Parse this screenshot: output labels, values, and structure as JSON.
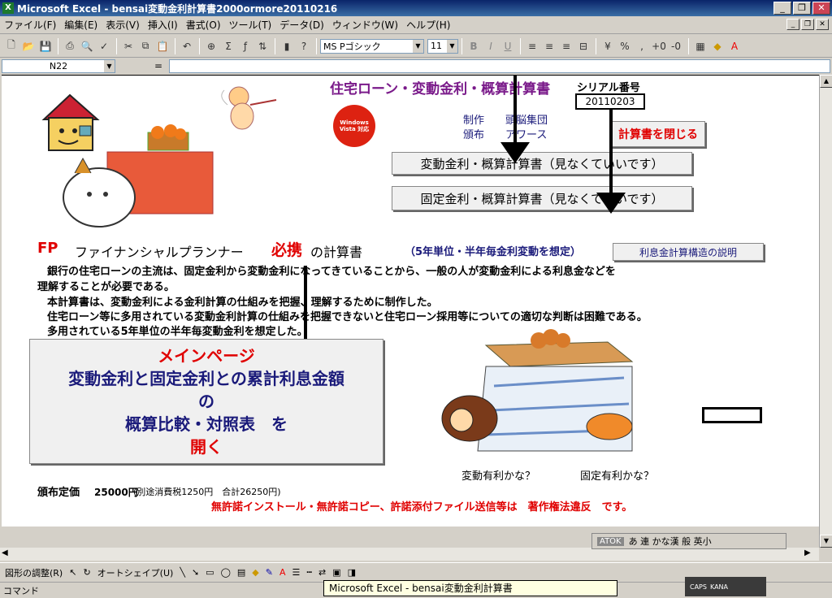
{
  "window": {
    "title": "Microsoft Excel - bensai変動金利計算書2000ormore20110216"
  },
  "menu": [
    "ファイル(F)",
    "編集(E)",
    "表示(V)",
    "挿入(I)",
    "書式(O)",
    "ツール(T)",
    "データ(D)",
    "ウィンドウ(W)",
    "ヘルプ(H)"
  ],
  "toolbar": {
    "font_name": "MS Pゴシック",
    "font_size": "11"
  },
  "formula": {
    "namebox": "N22",
    "eq": "=",
    "value": ""
  },
  "sheet": {
    "header_title": "住宅ローン・変動金利・概算計算書",
    "serial_label": "シリアル番号",
    "serial_value": "20110203",
    "credit1": "制作　　頭脳集団",
    "credit2": "頒布　　アワース",
    "vista_badge": "Windows Vista 対応",
    "close_btn": "計算書を閉じる",
    "btn_variable": "変動金利・概算計算書（見なくていいです）",
    "btn_fixed": "固定金利・概算計算書（見なくていいです）",
    "fp": "FP",
    "fp_title": "ファイナンシャルプランナー",
    "hikkei": "必携",
    "calc_doc": "の計算書",
    "note_5yr": "（5年単位・半年毎金利変動を想定）",
    "btn_structure": "利息金計算構造の説明",
    "para1": "銀行の住宅ローンの主流は、固定金利から変動金利になってきていることから、一般の人が変動金利による利息金などを",
    "para2": "理解することが必要である。",
    "para3": "本計算書は、変動金利による金利計算の仕組みを把握、理解するために制作した。",
    "para4": "住宅ローン等に多用されている変動金利計算の仕組みを把握できないと住宅ローン採用等についての適切な判断は困難である。",
    "para5": "多用されている5年単位の半年毎変動金利を想定した。",
    "main_line1": "メインページ",
    "main_line2": "変動金利と固定金利との累計利息金額",
    "main_line3": "の",
    "main_line4": "概算比較・対照表　を",
    "main_line5": "開く",
    "cap_variable": "変動有利かな？",
    "cap_fixed": "固定有利かな？",
    "price_label": "頒布定価",
    "price_value": "25000円",
    "price_tax": "(別途消費税1250円　合計26250円)",
    "warning": "無許諾インストール・無許諾コピー、許諾添付ファイル送信等は　著作権法違反　です。"
  },
  "drawbar": {
    "adjust": "図形の調整(R)",
    "autoshape": "オートシェイプ(U)"
  },
  "ime": {
    "atok": "ATOK",
    "items": "あ 連 かな漢 般 英小"
  },
  "status": {
    "text": "コマンド",
    "tooltip": "Microsoft Excel - bensai変動金利計算書2000ormore20110216",
    "caps": "CAPS",
    "kana": "KANA"
  },
  "colors": {
    "title_bar": "#0a246a",
    "red_text": "#e00000",
    "navy_text": "#1a1a7a",
    "purple_text": "#7a1a8a"
  }
}
